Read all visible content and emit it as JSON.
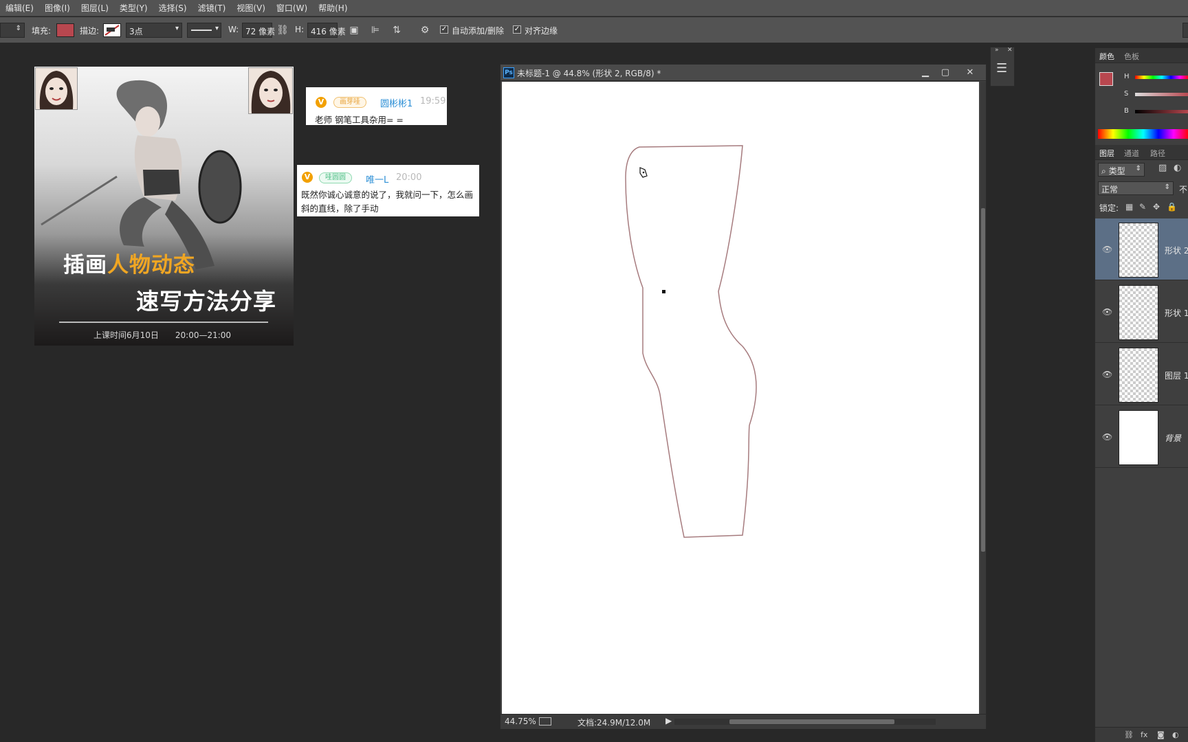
{
  "menu": [
    "编辑(E)",
    "图像(I)",
    "图层(L)",
    "类型(Y)",
    "选择(S)",
    "滤镜(T)",
    "视图(V)",
    "窗口(W)",
    "帮助(H)"
  ],
  "options": {
    "fill_label": "填充:",
    "stroke_label": "描边:",
    "stroke_size": "3点",
    "w_label": "W:",
    "w_value": "72 像素",
    "h_label": "H:",
    "h_value": "416 像素",
    "auto_add_delete": "自动添加/删除",
    "align_edges": "对齐边缘",
    "fill_color": "#b8474f"
  },
  "poster": {
    "title_part1": "插画",
    "title_highlight": "人物动态",
    "title_line2": "速写方法分享",
    "schedule": "上课时间6月10日　　20:00—21:00"
  },
  "chat": [
    {
      "badge": "V",
      "tag": "画芽哇",
      "nick": "圆彬彬1",
      "time": "19:59",
      "message": "老师 钢笔工具杂用= ="
    },
    {
      "badge": "V",
      "tag": "哇圆圆",
      "nick": "唯一L",
      "time": "20:00",
      "message": "既然你诚心诚意的说了，我就问一下，怎么画斜的直线，除了手动"
    }
  ],
  "document": {
    "app_badge": "Ps",
    "title": "未标题-1 @ 44.8% (形状 2, RGB/8) *",
    "zoom": "44.75%",
    "doc_size": "文档:24.9M/12.0M"
  },
  "panel": {
    "color_tabs": [
      "颜色",
      "色板"
    ],
    "sliders": [
      "H",
      "S",
      "B"
    ],
    "layer_tabs": [
      "图层",
      "通道",
      "路径"
    ],
    "kind_filter": "类型",
    "blend_mode": "正常",
    "opacity_label": "不",
    "lock_label": "锁定:",
    "layers": [
      {
        "name": "形状 2",
        "selected": true
      },
      {
        "name": "形状 1",
        "selected": false
      },
      {
        "name": "图层 1",
        "selected": false
      },
      {
        "name": "背景",
        "selected": false
      }
    ],
    "fg_color": "#b8474f"
  }
}
